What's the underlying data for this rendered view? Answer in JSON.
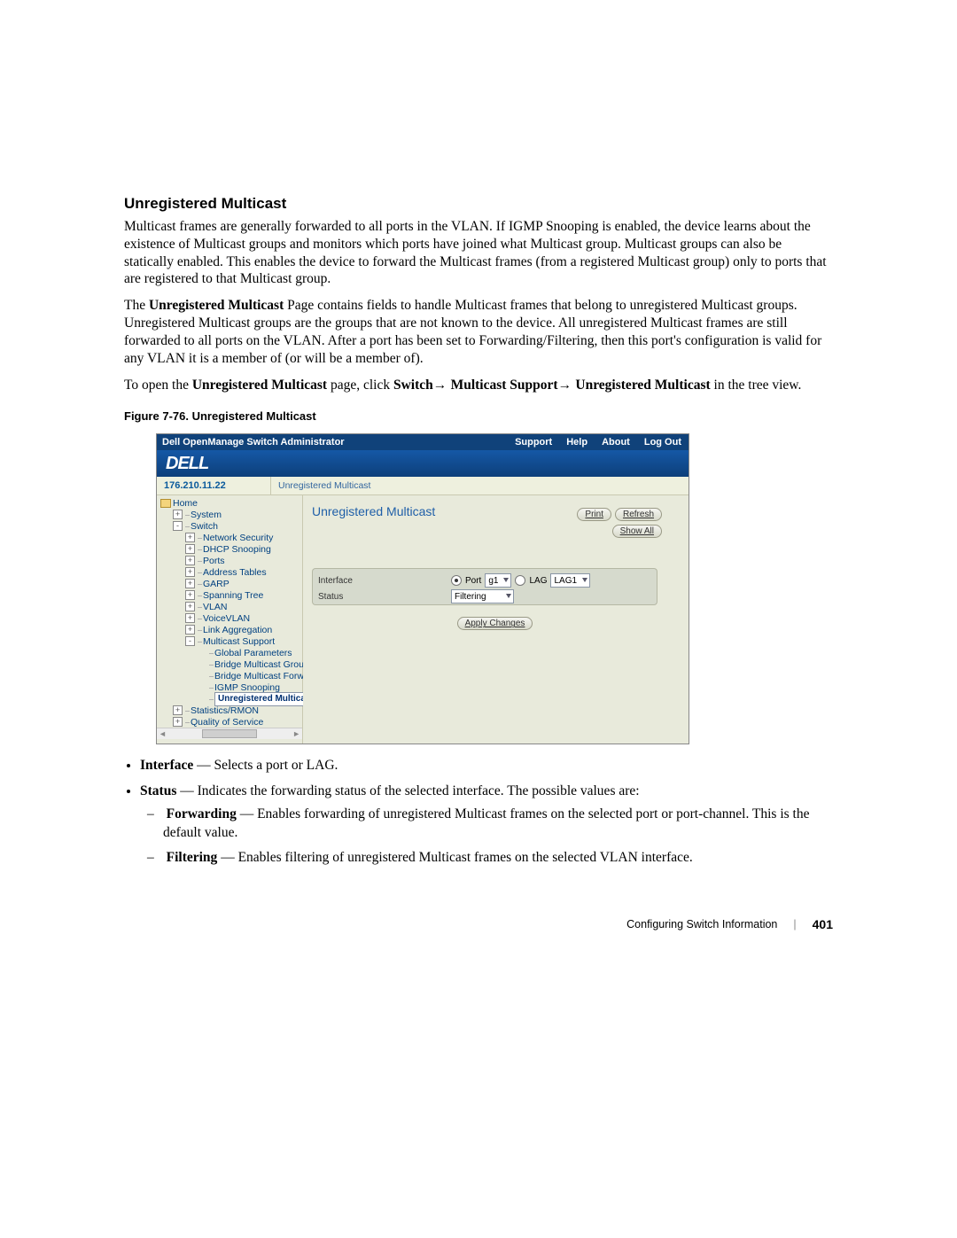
{
  "section_title": "Unregistered Multicast",
  "para1": "Multicast frames are generally forwarded to all ports in the VLAN. If IGMP Snooping is enabled, the device learns about the existence of Multicast groups and monitors which ports have joined what Multicast group. Multicast groups can also be statically enabled. This enables the device to forward the Multicast frames (from a registered Multicast group) only to ports that are registered to that Multicast group.",
  "para2_pre": "The ",
  "para2_bold1": "Unregistered Multicast",
  "para2_post": " Page contains fields to handle Multicast frames that belong to unregistered Multicast groups. Unregistered Multicast groups are the groups that are not known to the device. All unregistered Multicast frames are still forwarded to all ports on the VLAN. After a port has been set to Forwarding/Filtering, then this port's configuration is valid for any VLAN it is a member of (or will be a member of).",
  "para3_pre": "To open the ",
  "para3_bold1": "Unregistered Multicast",
  "para3_mid1": " page, click ",
  "para3_bold2": "Switch",
  "para3_bold3": "Multicast Support",
  "para3_bold4": "Unregistered Multicast",
  "para3_post": " in the tree view.",
  "arrow": "→ ",
  "figure_caption": "Figure 7-76.    Unregistered Multicast",
  "shot": {
    "titlebar": {
      "app": "Dell OpenManage Switch Administrator",
      "links": [
        "Support",
        "Help",
        "About",
        "Log Out"
      ]
    },
    "logo": "DELL",
    "ip": "176.210.11.22",
    "breadcrumb": "Unregistered Multicast",
    "tree": [
      {
        "pad": 0,
        "icon": "home",
        "label": "Home"
      },
      {
        "pad": 1,
        "icon": "plus",
        "label": "System"
      },
      {
        "pad": 1,
        "icon": "minus",
        "label": "Switch"
      },
      {
        "pad": 2,
        "icon": "plus",
        "label": "Network Security"
      },
      {
        "pad": 2,
        "icon": "plus",
        "label": "DHCP Snooping"
      },
      {
        "pad": 2,
        "icon": "plus",
        "label": "Ports"
      },
      {
        "pad": 2,
        "icon": "plus",
        "label": "Address Tables"
      },
      {
        "pad": 2,
        "icon": "plus",
        "label": "GARP"
      },
      {
        "pad": 2,
        "icon": "plus",
        "label": "Spanning Tree"
      },
      {
        "pad": 2,
        "icon": "plus",
        "label": "VLAN"
      },
      {
        "pad": 2,
        "icon": "plus",
        "label": "VoiceVLAN"
      },
      {
        "pad": 2,
        "icon": "plus",
        "label": "Link Aggregation"
      },
      {
        "pad": 2,
        "icon": "minus",
        "label": "Multicast Support"
      },
      {
        "pad": 3,
        "icon": "leaf",
        "label": "Global Parameters"
      },
      {
        "pad": 3,
        "icon": "leaf",
        "label": "Bridge Multicast Group"
      },
      {
        "pad": 3,
        "icon": "leaf",
        "label": "Bridge Multicast Forward"
      },
      {
        "pad": 3,
        "icon": "leaf",
        "label": "IGMP Snooping"
      },
      {
        "pad": 3,
        "icon": "leaf",
        "label": "Unregistered Multicast",
        "sel": true
      },
      {
        "pad": 1,
        "icon": "plus",
        "label": "Statistics/RMON"
      },
      {
        "pad": 1,
        "icon": "plus",
        "label": "Quality of Service"
      }
    ],
    "content": {
      "heading": "Unregistered Multicast",
      "buttons": {
        "print": "Print",
        "refresh": "Refresh",
        "showall": "Show All"
      },
      "rows": {
        "interface_label": "Interface",
        "port_label": "Port",
        "port_value": "g1",
        "lag_label": "LAG",
        "lag_value": "LAG1",
        "status_label": "Status",
        "status_value": "Filtering"
      },
      "apply": "Apply Changes"
    }
  },
  "fields": {
    "interface_term": "Interface",
    "interface_desc": " — Selects a port or LAG.",
    "status_term": "Status",
    "status_desc": " — Indicates the forwarding status of the selected interface. The possible values are:",
    "forwarding_term": "Forwarding",
    "forwarding_desc": " — Enables forwarding of unregistered Multicast frames on the selected port or port-channel. This is the default value.",
    "filtering_term": "Filtering",
    "filtering_desc": " — Enables filtering of unregistered Multicast frames on the selected VLAN interface."
  },
  "footer": {
    "section": "Configuring Switch Information",
    "page": "401"
  }
}
